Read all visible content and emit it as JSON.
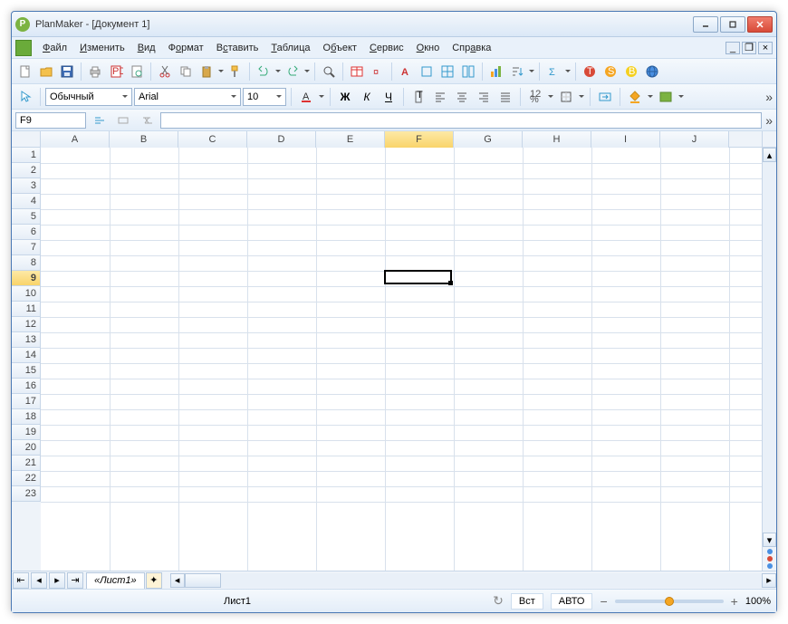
{
  "app": {
    "name": "PlanMaker",
    "document": "[Документ 1]"
  },
  "menu": {
    "items": [
      "Файл",
      "Изменить",
      "Вид",
      "Формат",
      "Вставить",
      "Таблица",
      "Объект",
      "Сервис",
      "Окно",
      "Справка"
    ]
  },
  "format": {
    "style": "Обычный",
    "font": "Arial",
    "size": "10"
  },
  "reference": {
    "cell": "F9",
    "formula": ""
  },
  "grid": {
    "columns": [
      "A",
      "B",
      "C",
      "D",
      "E",
      "F",
      "G",
      "H",
      "I",
      "J"
    ],
    "row_count": 23,
    "active_col": "F",
    "active_row": 9
  },
  "sheets": {
    "active": "«Лист1»"
  },
  "status": {
    "sheet": "Лист1",
    "insert_mode": "Вст",
    "calc_mode": "АВТО",
    "zoom": "100%"
  },
  "icons": {
    "minus": "−",
    "plus": "+",
    "refresh": "↻"
  }
}
